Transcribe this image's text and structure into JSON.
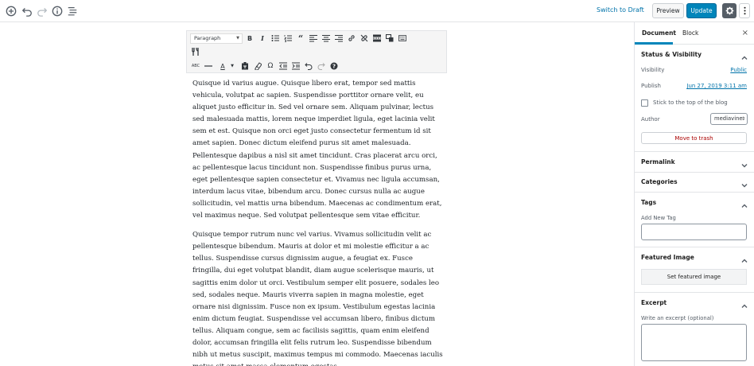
{
  "topbar": {
    "switch_to_draft": "Switch to Draft",
    "preview": "Preview",
    "update": "Update",
    "icons": [
      "add-block-icon",
      "undo-icon",
      "redo-icon",
      "info-icon",
      "outline-icon",
      "gear-icon",
      "more-vertical-icon"
    ]
  },
  "classic_toolbar": {
    "format_select": "Paragraph",
    "row1": [
      "bold",
      "italic",
      "bulleted-list",
      "numbered-list",
      "blockquote",
      "align-left",
      "align-center",
      "align-right",
      "insert-link",
      "remove-link",
      "read-more",
      "toolbar-toggle",
      "keyboard-shortcuts",
      "kitchen-sink"
    ],
    "row2": [
      "strikethrough",
      "horizontal-line",
      "text-color",
      "paste-as-text",
      "clear-formatting",
      "special-character",
      "decrease-indent",
      "increase-indent",
      "undo",
      "redo",
      "help"
    ]
  },
  "content": {
    "paragraphs": [
      "Quisque id varius augue. Quisque libero erat, tempor sed mattis vehicula, volutpat ac sapien. Suspendisse porttitor ornare velit, eu aliquet justo efficitur in. Sed vel ornare sem. Aliquam pulvinar, lectus sed malesuada mattis, lorem neque imperdiet ligula, eget lacinia velit sem et est. Quisque non orci eget justo consectetur fermentum id sit amet sapien. Donec dictum eleifend purus sit amet malesuada. Pellentesque dapibus a nisl sit amet tincidunt. Cras placerat arcu orci, ac pellentesque lacus tincidunt non. Suspendisse finibus purus urna, eget pellentesque sapien consectetur et. Vivamus nec ligula accumsan, interdum lacus vitae, bibendum arcu. Donec cursus nulla ac augue sollicitudin, vel mattis urna bibendum. Maecenas ac condimentum erat, vel maximus neque. Sed volutpat pellentesque sem vitae efficitur.",
      "Quisque tempor rutrum nunc vel varius. Vivamus sollicitudin velit ac pellentesque bibendum. Mauris at dolor et mi molestie efficitur a ac tellus. Suspendisse cursus dignissim augue, a feugiat ex. Fusce fringilla, dui eget volutpat blandit, diam augue scelerisque mauris, ut sagittis enim dolor ut orci. Vestibulum semper elit posuere, sodales leo sed, sodales neque. Mauris viverra sapien in magna molestie, eget ornare nisi dignissim. Fusce non ex ipsum. Vestibulum egestas lacinia enim dictum feugiat. Suspendisse vel accumsan libero, finibus dictum tellus. Aliquam congue, sem ac facilisis sagittis, quam enim eleifend dolor, accumsan fringilla elit felis rutrum leo. Suspendisse bibendum nibh ut metus suscipit, maximus tempus mi commodo. Maecenas iaculis metus sit amet massa elementum egestas."
    ]
  },
  "sidebar": {
    "tabs": [
      "Document",
      "Block"
    ],
    "close": "×",
    "status_visibility": {
      "title": "Status & Visibility",
      "visibility_label": "Visibility",
      "visibility_value": "Public",
      "publish_label": "Publish",
      "publish_value": "Jun 27, 2019 3:11 am",
      "sticky_label": "Stick to the top of the blog",
      "author_label": "Author",
      "author_value": "mediavine",
      "trash_label": "Move to trash"
    },
    "permalink": {
      "title": "Permalink"
    },
    "categories": {
      "title": "Categories"
    },
    "tags": {
      "title": "Tags",
      "add_label": "Add New Tag"
    },
    "featured_image": {
      "title": "Featured Image",
      "button": "Set featured image"
    },
    "excerpt": {
      "title": "Excerpt",
      "label": "Write an excerpt (optional)"
    }
  },
  "colors": {
    "accent": "#0085ba",
    "link": "#0073aa",
    "danger": "#aa0000"
  }
}
